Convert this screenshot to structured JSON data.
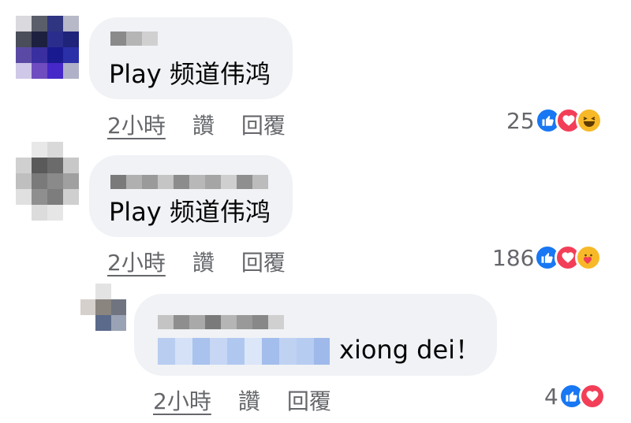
{
  "comments": [
    {
      "text": "Play 频道伟鸿",
      "time": "2小時",
      "like_label": "讚",
      "reply_label": "回覆",
      "reaction_count": "25",
      "reactions": [
        "like-icon",
        "love-icon",
        "haha-icon"
      ]
    },
    {
      "text": "Play 频道伟鸿",
      "time": "2小時",
      "like_label": "讚",
      "reply_label": "回覆",
      "reaction_count": "186",
      "reactions": [
        "like-icon",
        "love-icon",
        "care-icon"
      ]
    },
    {
      "text": "xiong dei！",
      "time": "2小時",
      "like_label": "讚",
      "reply_label": "回覆",
      "reaction_count": "4",
      "reactions": [
        "like-icon",
        "love-icon"
      ]
    }
  ],
  "colors": {
    "bubble": "#f0f2f5",
    "meta_text": "#65676b",
    "like": "#1877f2",
    "love": "#f33e58",
    "haha": "#f7b928"
  }
}
